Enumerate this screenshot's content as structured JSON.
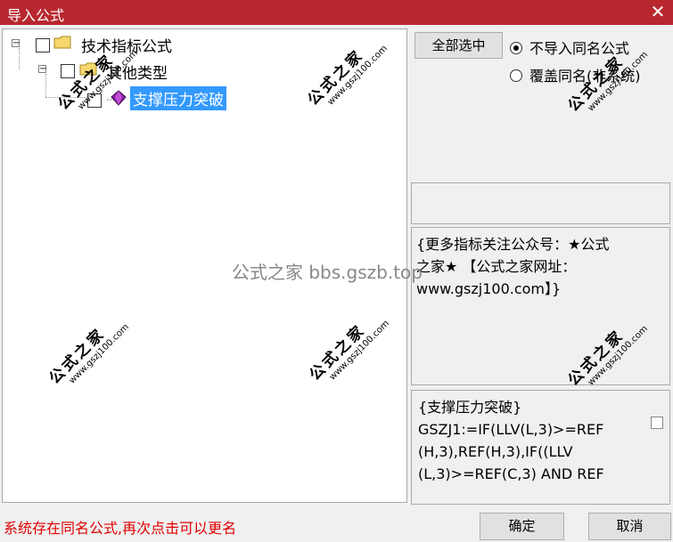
{
  "window": {
    "title": "导入公式",
    "close_glyph": "✕"
  },
  "tree": {
    "root": {
      "label": "技术指标公式",
      "expander": "−"
    },
    "child": {
      "label": "其他类型",
      "expander": "−"
    },
    "leaf": {
      "label": "支撑压力突破"
    }
  },
  "options": {
    "select_all_label": "全部选中",
    "radio_skip_label": "不导入同名公式",
    "radio_overwrite_label": "覆盖同名(非系统)",
    "selected_radio": "skip"
  },
  "description": {
    "line1": "{更多指标关注公众号：★公式",
    "line2": "之家★ 【公式之家网址：",
    "line3": "www.gszj100.com】}"
  },
  "code": {
    "line1": "{支撑压力突破}",
    "line2": "GSZJ1:=IF(LLV(L,3)>=REF",
    "line3": "(H,3),REF(H,3),IF((LLV",
    "line4": "(L,3)>=REF(C,3) AND REF"
  },
  "footer": {
    "status_message": "系统存在同名公式,再次点击可以更名",
    "ok_label": "确定",
    "cancel_label": "取消"
  },
  "watermark": {
    "text": "公式之家",
    "url": "www.gszj100.com",
    "center_text": "公式之家 bbs.gszb.top"
  }
}
